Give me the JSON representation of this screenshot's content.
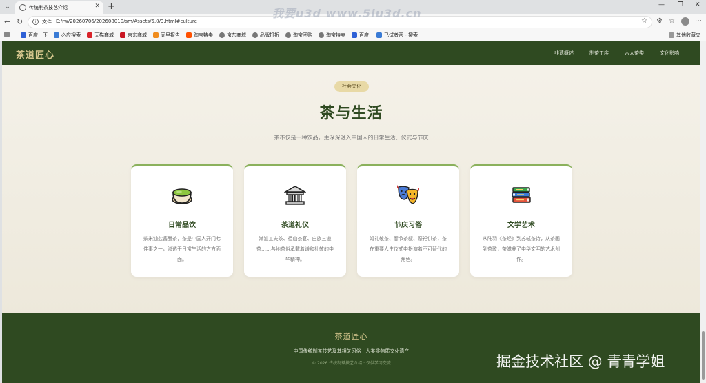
{
  "browser": {
    "tab_title": "传统制茶技艺介绍",
    "url_label": "文件",
    "url": "E:/rw/20260706/202608010/sm/Assets/5.0/3.html#culture",
    "bookmarks": [
      "百度一下",
      "必应搜索",
      "天猫商城",
      "京东商城",
      "同里报告",
      "淘宝特卖",
      "京东商城",
      "品牌打折",
      "淘宝团购",
      "淘宝特卖",
      "百度",
      "已试者密 - 搜索"
    ],
    "other_bookmarks": "其他收藏夹"
  },
  "site": {
    "logo": "茶道匠心",
    "nav": [
      "非遗概述",
      "制茶工序",
      "六大茶类",
      "文化影响"
    ]
  },
  "section": {
    "badge": "社会文化",
    "title": "茶与生活",
    "subtitle": "茶不仅是一种饮品，更深深融入中国人的日常生活、仪式与节庆"
  },
  "cards": [
    {
      "icon": "tea-bowl-icon",
      "title": "日常品饮",
      "desc": "柴米油盐酱醋茶，茶是中国人开门七件事之一，渗透于日常生活的方方面面。"
    },
    {
      "icon": "temple-icon",
      "title": "茶道礼仪",
      "desc": "潮汕工夫茶、径山茶宴、白族三道茶……各地茶俗承载着谦和礼敬的中华精神。"
    },
    {
      "icon": "theater-masks-icon",
      "title": "节庆习俗",
      "desc": "婚礼敬茶、春节茶叙、祭祀供茶，茶在重要人生仪式中扮演着不可替代的角色。"
    },
    {
      "icon": "books-icon",
      "title": "文学艺术",
      "desc": "从陆羽《茶经》到苏轼茶诗，从茶画到茶歌，茶滋养了中华文明的艺术创作。"
    }
  ],
  "footer": {
    "title": "茶道匠心",
    "line1": "中国传统制茶技艺及其相关习俗 · 人类非物质文化遗产",
    "line2": "© 2026 传统制茶技艺介绍 · 仅供学习交流"
  },
  "watermarks": {
    "top": "我要u3d www.5lu3d.cn",
    "bottom": "掘金技术社区 @ 青青学姐"
  }
}
